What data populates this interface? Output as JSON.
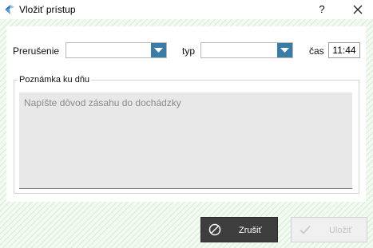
{
  "window": {
    "title": "Vložiť prístup",
    "help_label": "?"
  },
  "form": {
    "interruption_label": "Prerušenie",
    "interruption_value": "",
    "type_label": "typ",
    "type_value": "",
    "time_label": "čas",
    "time_value": "11:44"
  },
  "note": {
    "group_title": "Poznámka ku dňu",
    "placeholder": "Napíšte dôvod zásahu do dochádzky",
    "value": ""
  },
  "buttons": {
    "cancel_label": "Zrušiť",
    "save_label": "Uložiť"
  },
  "colors": {
    "combo_arrow": "#3a7ca5",
    "cancel_bg": "#3e3e3e",
    "background_stripes": "#d5ecd5"
  },
  "icons": {
    "app": "app-logo-icon",
    "close": "close-icon",
    "dropdown": "chevron-down-icon",
    "cancel": "cancel-circle-icon",
    "save": "checkmark-icon"
  }
}
